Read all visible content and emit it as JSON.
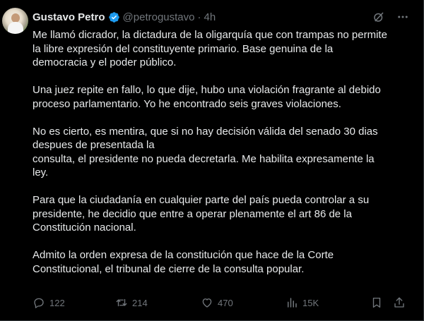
{
  "colors": {
    "background": "#000000",
    "text": "#e7e9ea",
    "muted": "#71767b",
    "verified": "#1d9bf0",
    "border": "#2f3336"
  },
  "author": {
    "name": "Gustavo Petro",
    "handle": "@petrogustavo",
    "separator": "·",
    "time": "4h",
    "verified_icon": "verified-badge-icon"
  },
  "header_icons": [
    "grok-icon",
    "more-options-icon"
  ],
  "paragraphs": [
    "Me llamó dicrador, la dictadura de la oligarquía que con trampas no permite\nla libre expresión del constituyente primario. Base genuina de la\ndemocracia y el poder público.",
    "Una juez repite en fallo, lo que dije, hubo una violación fragrante al debido\nproceso parlamentario. Yo he encontrado seis graves violaciones.",
    "No es cierto, es mentira, que si no hay decisión válida del senado 30 dias\ndespues de presentada la\n consulta, el presidente no pueda decretarla. Me habilita expresamente la\nley.",
    "Para que la ciudadanía en cualquier parte del país pueda controlar a su\npresidente, he decidio que entre a operar plenamente el art 86 de la\nConstitución nacional.",
    "Admito la orden expresa de la constitución que hace de la Corte\nConstitucional, el tribunal de cierre de la consulta popular."
  ],
  "actions": {
    "replies": "122",
    "reposts": "214",
    "likes": "470",
    "views": "15K",
    "icons": [
      "reply-icon",
      "repost-icon",
      "like-icon",
      "views-icon",
      "bookmark-icon",
      "share-icon"
    ]
  }
}
